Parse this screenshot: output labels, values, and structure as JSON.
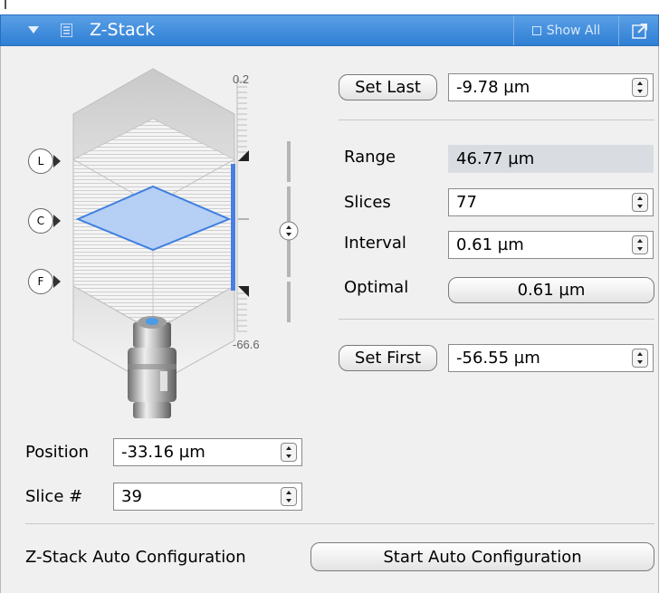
{
  "title": "Z-Stack",
  "show_all_label": "Show All",
  "set_last": {
    "button": "Set Last",
    "value": "-9.78 µm"
  },
  "range": {
    "label": "Range",
    "value": "46.77 µm"
  },
  "slices": {
    "label": "Slices",
    "value": "77"
  },
  "interval": {
    "label": "Interval",
    "value": "0.61 µm"
  },
  "optimal": {
    "label": "Optimal",
    "value": "0.61 µm"
  },
  "set_first": {
    "button": "Set First",
    "value": "-56.55 µm"
  },
  "scale": {
    "top": "0.2",
    "bottom": "-66.6"
  },
  "markers": {
    "last": "L",
    "center": "C",
    "first": "F"
  },
  "position": {
    "label": "Position",
    "value": "-33.16 µm"
  },
  "slice_number": {
    "label": "Slice #",
    "value": "39"
  },
  "auto_config": {
    "label": "Z-Stack Auto Configuration",
    "button": "Start Auto Configuration"
  },
  "colors": {
    "title_bar": "#3b8ad9",
    "accent": "#4a7fe0",
    "panel_bg": "#f0f0f0"
  },
  "icons": {
    "collapse": "triangle-down-icon",
    "menu": "list-icon",
    "popout": "popout-icon",
    "objective": "objective-lens-icon",
    "slider": "slider-handle-icon"
  }
}
